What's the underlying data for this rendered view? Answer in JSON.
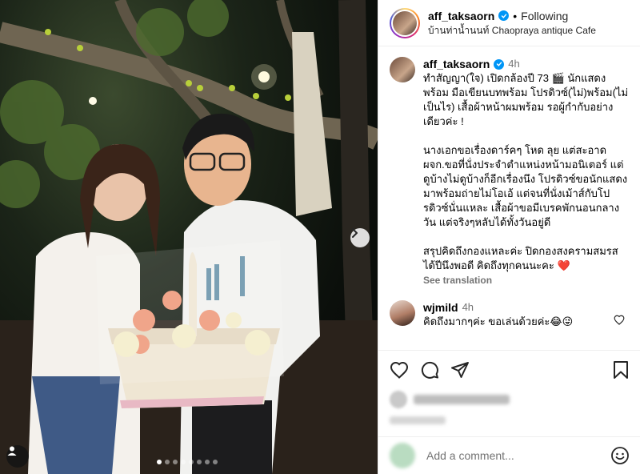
{
  "post": {
    "username": "aff_taksaorn",
    "separator": "•",
    "follow_status": "Following",
    "location": "บ้านท่าน้ำนนท์ Chaopraya antique Cafe"
  },
  "caption": {
    "username": "aff_taksaorn",
    "time": "4h",
    "text": "ทำสัญญา(ใจ) เปิดกล้องปี 73 🎬 นักแสดงพร้อม มือเขียนบทพร้อม โปรดิวซ์(ไม่)พร้อม(ไม่เป็นไร) เสื้อผ้าหน้าผมพร้อม รอผู้กำกับอย่างเดียวค่ะ !\n\nนางเอกขอเรื่องดาร์คๆ โหด ลุย แต่สะอาด ผจก.ขอที่นั่งประจำตำแหน่งหน้ามอนิเตอร์ แต่ดูบ้างไม่ดูบ้างก็อีกเรื่องนึง โปรดิวซ์ขอนักแสดงมาพร้อมถ่ายไม่โอเอ้ แต่จนที่นั่งเม้าส์กับโปรดิวซ์นั่นแหละ เสื้อผ้าขอมีเบรคพักนอนกลางวัน แต่จริงๆหลับได้ทั้งวันอยู่ดี\n\nสรุปคิดถึงกองแหละค่ะ ปิดกองสงครามสมรสได้ปีนึงพอดี คิดถึงทุกคนนะคะ ❤️",
    "see_translation": "See translation"
  },
  "comments": [
    {
      "username": "wjmild",
      "time": "4h",
      "text": "คิดถึงมากๆค่ะ ขอเล่นด้วยค่ะ😂😜"
    }
  ],
  "add_comment": {
    "placeholder": "Add a comment..."
  },
  "carousel": {
    "slides": 8,
    "active_index": 0
  },
  "colors": {
    "verified": "#0095f6",
    "heart": "#ed4956",
    "muted": "#737373"
  },
  "icons": [
    "verified-badge-icon",
    "like-icon",
    "comment-icon",
    "share-icon",
    "save-icon",
    "emoji-icon",
    "next-arrow-icon",
    "user-tag-icon"
  ]
}
